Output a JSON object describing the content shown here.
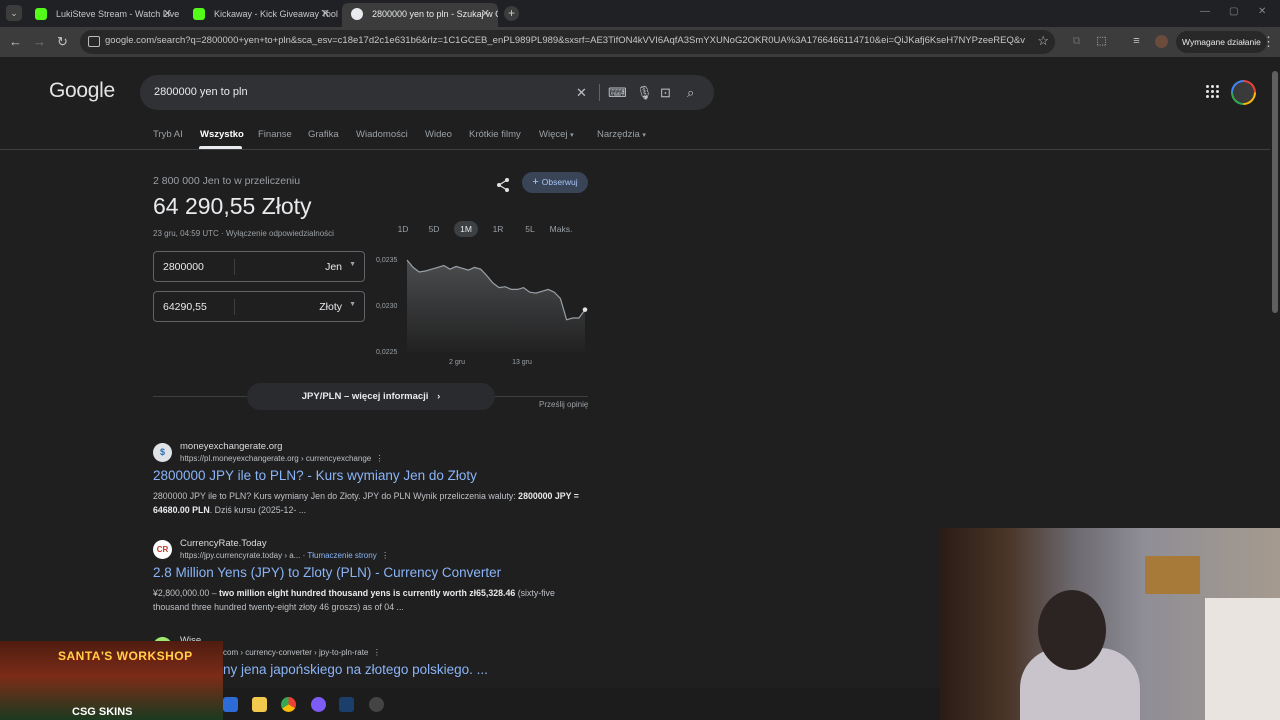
{
  "browser": {
    "tabs": [
      {
        "title": "LukiSteve Stream - Watch Live o",
        "favicon_color": "#53fc18",
        "active": false
      },
      {
        "title": "Kickaway - Kick Giveaway Tool",
        "favicon_color": "#53fc18",
        "active": false
      },
      {
        "title": "2800000 yen to pln - Szukaj w G",
        "favicon_color": "#e8eaed",
        "active": true
      }
    ],
    "new_tab": "+",
    "url": "google.com/search?q=2800000+yen+to+pln&sca_esv=c18e17d2c1e631b6&rlz=1C1GCEB_enPL989PL989&sxsrf=AE3TifON4kVVI6AqfA3SmYXUNoG2OKR0UA%3A1766466114710&ei=QiJKafj6KseH7NYPzeeREQ&ved=0ahU...",
    "required_action": "Wymagane działanie"
  },
  "google": {
    "logo": "Google",
    "query": "2800000 yen to pln",
    "tabs": [
      "Tryb AI",
      "Wszystko",
      "Finanse",
      "Grafika",
      "Wiadomości",
      "Wideo",
      "Krótkie filmy",
      "Więcej",
      "Narzędzia"
    ],
    "active_tab": "Wszystko"
  },
  "converter": {
    "subtitle": "2 800 000 Jen to w przeliczeniu",
    "result": "64 290,55 Złoty",
    "timestamp": "23 gru, 04:59 UTC",
    "disclaimer": "Wyłączenie odpowiedzialności",
    "follow_label": "Obserwuj",
    "from": {
      "value": "2800000",
      "currency": "Jen"
    },
    "to": {
      "value": "64290,55",
      "currency": "Złoty"
    },
    "ranges": [
      "1D",
      "5D",
      "1M",
      "1R",
      "5L",
      "Maks."
    ],
    "active_range": "1M",
    "more_info": "JPY/PLN – więcej informacji",
    "feedback": "Prześlij opinię"
  },
  "chart_data": {
    "type": "area",
    "title": "",
    "xlabel": "",
    "ylabel": "",
    "x_ticks": [
      "2 gru",
      "13 gru"
    ],
    "y_ticks": [
      "0,0235",
      "0,0230",
      "0,0225"
    ],
    "ylim": [
      0.0225,
      0.0235
    ],
    "x": [
      0,
      1,
      2,
      3,
      4,
      5,
      6,
      7,
      8,
      9,
      10,
      11,
      12,
      13,
      14,
      15,
      16,
      17,
      18,
      19,
      20,
      21,
      22,
      23,
      24,
      25,
      26,
      27,
      28,
      29
    ],
    "values": [
      0.0235,
      0.02342,
      0.02337,
      0.02338,
      0.0234,
      0.02342,
      0.02344,
      0.0234,
      0.02343,
      0.02341,
      0.02339,
      0.02342,
      0.0234,
      0.02333,
      0.02325,
      0.0232,
      0.02321,
      0.02318,
      0.02318,
      0.0232,
      0.02315,
      0.02314,
      0.02316,
      0.02318,
      0.02315,
      0.02308,
      0.02285,
      0.02287,
      0.02287,
      0.02296
    ],
    "series_color": "#9aa0a6"
  },
  "results": [
    {
      "site": "moneyexchangerate.org",
      "url": "https://pl.moneyexchangerate.org › currencyexchange",
      "title": "2800000 JPY ile to PLN? - Kurs wymiany Jen do Złoty",
      "snippet_pre": "2800000 JPY ile to PLN? Kurs wymiany Jen do Złoty. JPY do PLN Wynik przeliczenia waluty: ",
      "snippet_bold": "2800000 JPY = 64680.00 PLN",
      "snippet_post": ". Dziś kursu (2025-12- ...",
      "fav_label": "$",
      "fav_color": "#dfe3e7"
    },
    {
      "site": "CurrencyRate.Today",
      "url": "https://jpy.currencyrate.today › a...",
      "translate": "Tłumaczenie strony",
      "title": "2.8 Million Yens (JPY) to Zloty (PLN) - Currency Converter",
      "snippet_pre": "¥2,800,000.00 – ",
      "snippet_bold": "two million eight hundred thousand yens is currently worth zł65,328.46",
      "snippet_post": " (sixty-five thousand three hundred twenty-eight złoty 46 groszs) as of 04 ...",
      "fav_label": "CR",
      "fav_color": "#ffffff"
    },
    {
      "site": "Wise",
      "url": "com › currency-converter › jpy-to-pln-rate",
      "title": "ny jena japońskiego na złotego polskiego. ...",
      "snippet_pre": "",
      "snippet_bold": "",
      "snippet_post": "",
      "fav_label": "",
      "fav_color": "#9fe870"
    }
  ],
  "overlay": {
    "promo_title": "SANTA'S WORKSHOP",
    "promo_brand": "CSG SKINS"
  }
}
